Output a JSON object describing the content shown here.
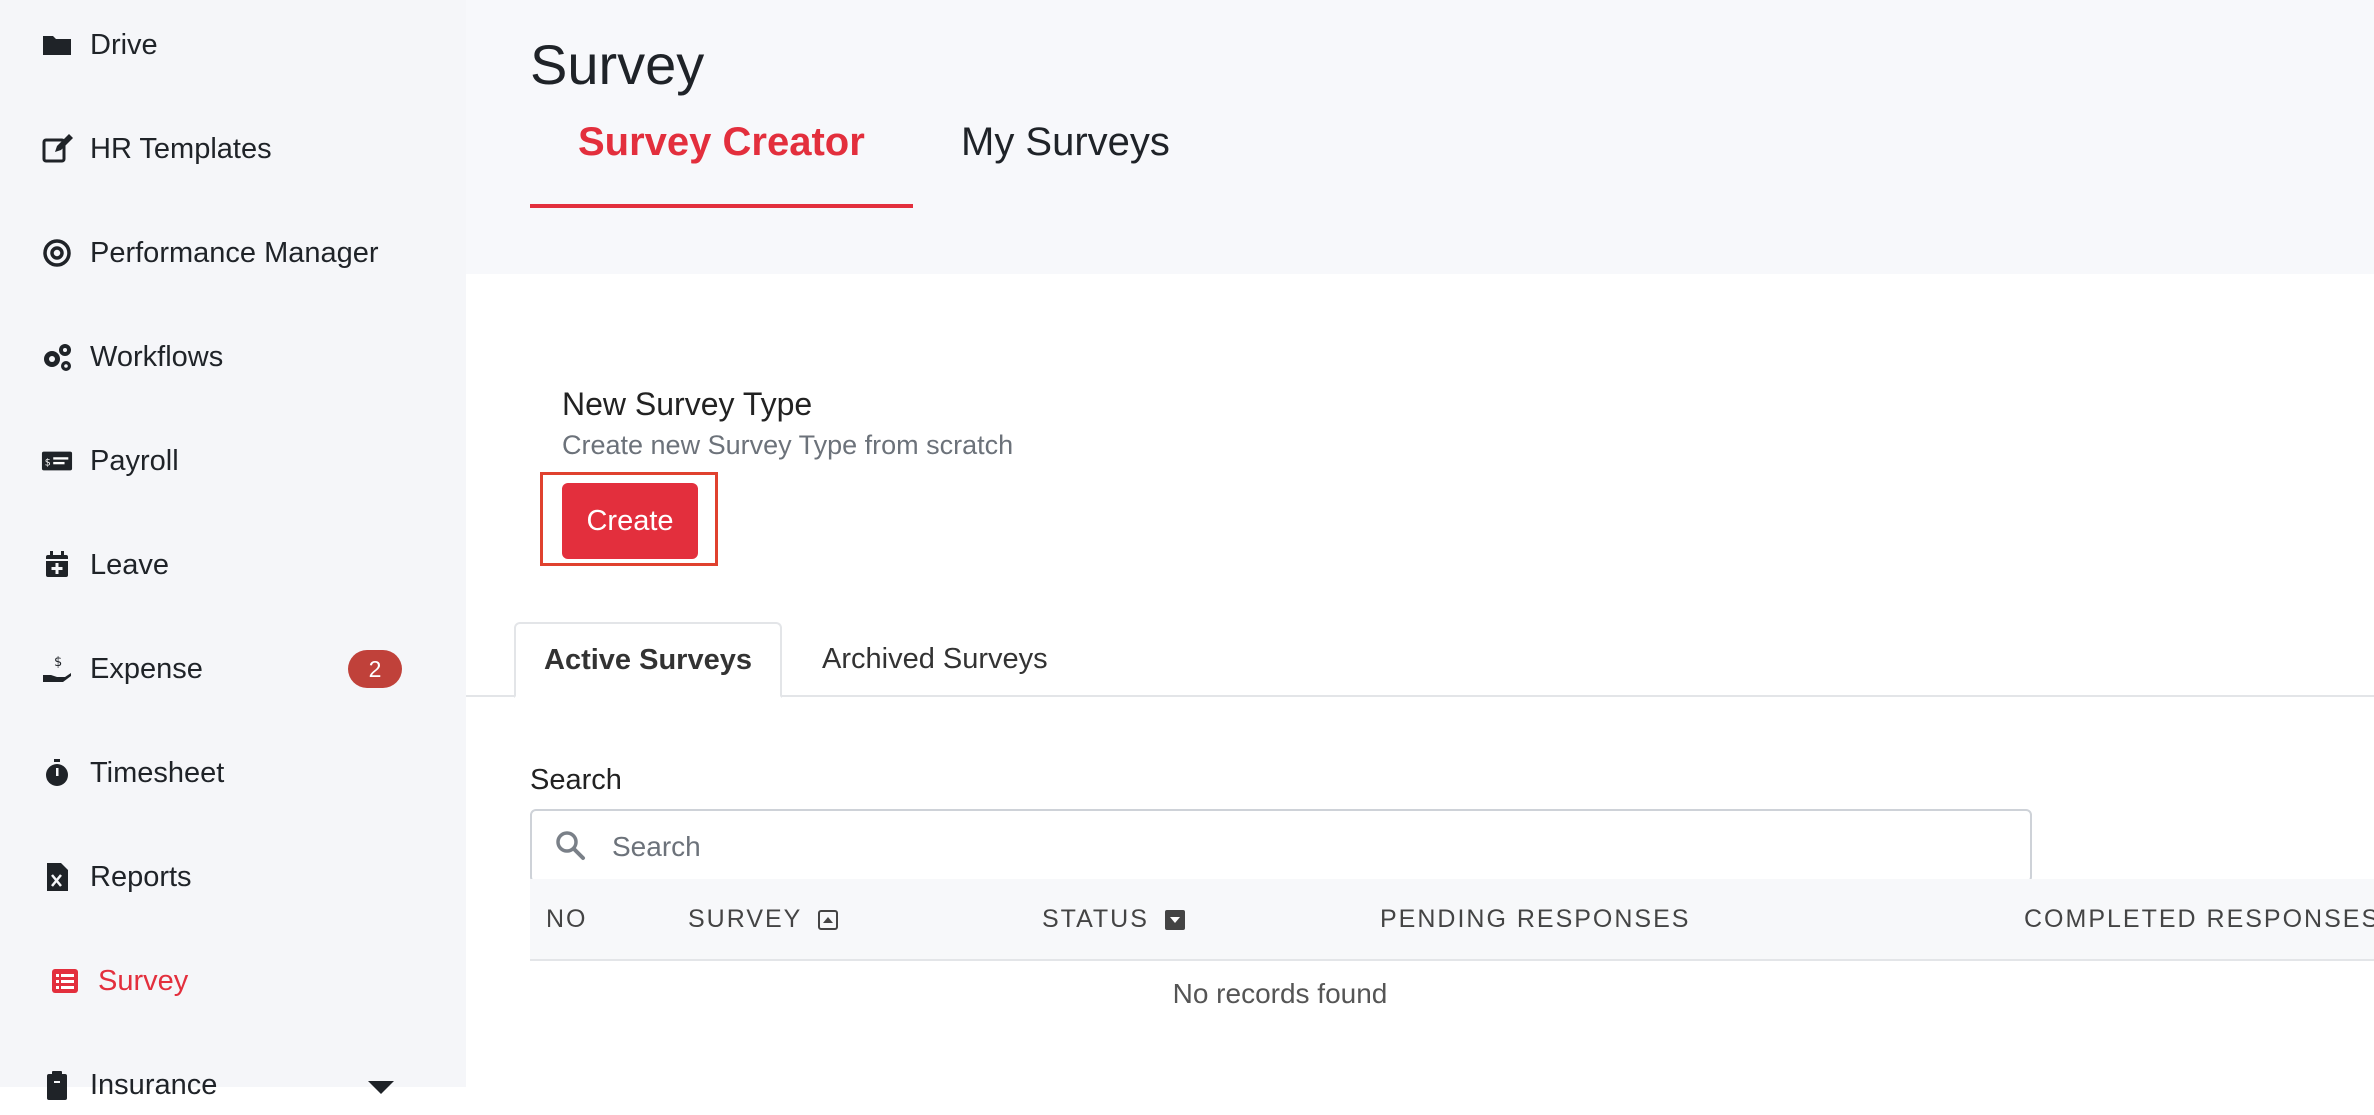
{
  "sidebar": {
    "items": [
      {
        "label": "Drive",
        "icon": "folder-icon"
      },
      {
        "label": "HR Templates",
        "icon": "edit-icon"
      },
      {
        "label": "Performance Manager",
        "icon": "target-icon"
      },
      {
        "label": "Workflows",
        "icon": "gears-icon"
      },
      {
        "label": "Payroll",
        "icon": "money-check-icon"
      },
      {
        "label": "Leave",
        "icon": "calendar-plus-icon"
      },
      {
        "label": "Expense",
        "icon": "hand-dollar-icon",
        "badge": "2"
      },
      {
        "label": "Timesheet",
        "icon": "stopwatch-icon"
      },
      {
        "label": "Reports",
        "icon": "file-excel-icon"
      },
      {
        "label": "Survey",
        "icon": "list-icon",
        "active": true
      },
      {
        "label": "Insurance",
        "icon": "clipboard-icon"
      }
    ]
  },
  "header": {
    "title": "Survey",
    "tabs": [
      {
        "label": "Survey Creator",
        "active": true
      },
      {
        "label": "My Surveys",
        "active": false
      }
    ]
  },
  "new_survey": {
    "title": "New Survey Type",
    "subtitle": "Create new Survey Type from scratch",
    "create_label": "Create"
  },
  "sub_tabs": [
    {
      "label": "Active Surveys",
      "active": true
    },
    {
      "label": "Archived Surveys",
      "active": false
    }
  ],
  "search": {
    "label": "Search",
    "placeholder": "Search",
    "value": ""
  },
  "table": {
    "columns": [
      "NO",
      "SURVEY",
      "STATUS",
      "PENDING RESPONSES",
      "COMPLETED RESPONSES"
    ],
    "empty_message": "No records found"
  },
  "colors": {
    "accent": "#e32f3d",
    "badge": "#c0413a",
    "sidebar_bg": "#f5f6f9"
  }
}
